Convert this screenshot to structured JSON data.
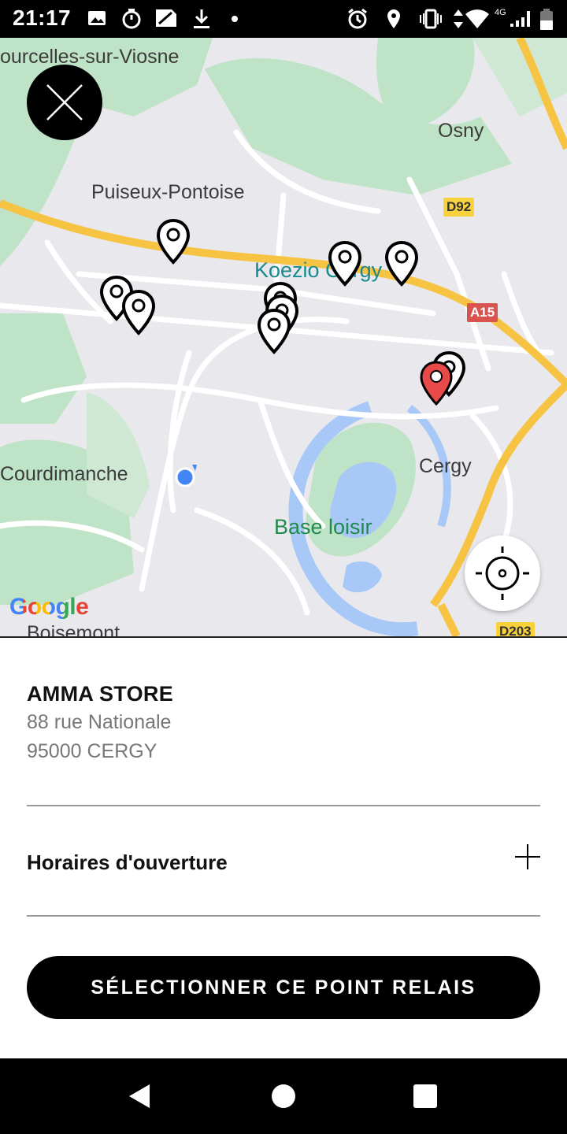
{
  "status_bar": {
    "time": "21:17",
    "network": "4G",
    "icons": [
      "image-icon",
      "timer-icon",
      "sim-icon",
      "download-icon",
      "dot-icon",
      "alarm-icon",
      "location-icon",
      "vibrate-icon",
      "data-arrows-icon",
      "wifi-icon",
      "signal-icon",
      "battery-icon"
    ]
  },
  "map": {
    "places": {
      "courcelles": "ourcelles-sur-Viosne",
      "osny": "Osny",
      "puiseux": "Puiseux-Pontoise",
      "koezio": "Koezio Cergy",
      "courdimanche": "Courdimanche",
      "cergy": "Cergy",
      "base_loisir": "Base loisir",
      "boisemont": "Boisemont"
    },
    "roads": {
      "d92": "D92",
      "a15": "A15",
      "d203": "D203"
    },
    "attribution": "Google",
    "colors": {
      "road_major": "#f6c343",
      "road_minor": "#ffffff",
      "park": "#bfe3c6",
      "water": "#a8c8f8",
      "selected_pin": "#e84a4a",
      "pin": "#000000",
      "user_location": "#4285f4"
    }
  },
  "store": {
    "name": "AMMA STORE",
    "address_line1": "88 rue Nationale",
    "address_line2": "95000 CERGY"
  },
  "hours": {
    "label": "Horaires d'ouverture"
  },
  "action": {
    "select_label": "SÉLECTIONNER CE POINT RELAIS"
  },
  "nav": {
    "icons": [
      "back-icon",
      "home-icon",
      "recents-icon"
    ]
  }
}
